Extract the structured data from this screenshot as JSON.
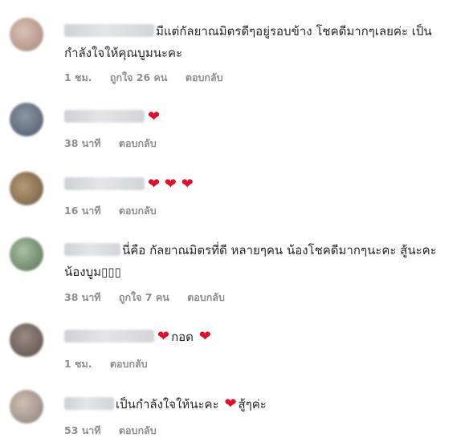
{
  "comments": [
    {
      "text": "มีแต่กัลยาณมิตรดีๆอยู่รอบข้าง โชคดีมากๆเลยค่ะ เป็นกำลังใจให้คุณบูมนะคะ",
      "time": "1 ชม.",
      "likes": "ถูกใจ 26 คน",
      "reply": "ตอบกลับ",
      "avatar_color": "#b89a8c"
    },
    {
      "text": "",
      "hearts_after": "❤",
      "time": "38 นาที",
      "reply": "ตอบกลับ",
      "avatar_color": "#5f6b78"
    },
    {
      "text": "",
      "hearts_after": "❤ ❤ ❤",
      "time": "16 นาที",
      "reply": "ตอบกลับ",
      "avatar_color": "#8a7356"
    },
    {
      "text": "นี่คือ กัลยาณมิตรที่ดี หลายๆคน น้องโชคดีมากๆนะคะ สู้นะคะน้องบูม",
      "boxes": "▯▯▯",
      "time": "38 นาที",
      "likes": "ถูกใจ 7 คน",
      "reply": "ตอบกลับ",
      "avatar_color": "#6f8a6a"
    },
    {
      "pre_heart": "❤",
      "text": "กอด",
      "post_heart": "❤",
      "time": "1 ชม.",
      "reply": "ตอบกลับ",
      "avatar_color": "#6e5f5a"
    },
    {
      "text": "เป็นกำลังใจให้นะคะ",
      "mid_heart": "❤",
      "text2": "สู้ๆค่ะ",
      "time": "53 นาที",
      "reply": "ตอบกลับ",
      "avatar_color": "#a69c93"
    }
  ]
}
